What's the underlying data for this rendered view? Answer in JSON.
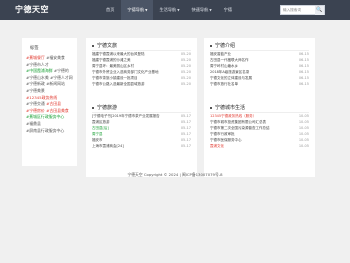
{
  "brand": {
    "logo": "宁德天空"
  },
  "nav": [
    {
      "label": "首页",
      "caret": ""
    },
    {
      "label": "宁德导航",
      "caret": "▼"
    },
    {
      "label": "生活导航",
      "caret": "▼"
    },
    {
      "label": "快速导航",
      "caret": "▼"
    },
    {
      "label": "宁德",
      "caret": ""
    }
  ],
  "search": {
    "placeholder": "输入搜索词",
    "button_icon": "🔍"
  },
  "sidebar": {
    "title": "标签",
    "tags": [
      {
        "text": "#蕉城餐厅",
        "color": "red"
      },
      {
        "text": "#福安美食",
        "color": "gray"
      },
      {
        "text": "#宁德市人才",
        "color": "gray"
      },
      {
        "text": "#中国霞浦海鲜",
        "color": "green"
      },
      {
        "text": "#宁德的",
        "color": "gray"
      },
      {
        "text": "#宁德山水美",
        "color": "gray"
      },
      {
        "text": "#宁德人才网",
        "color": "gray"
      },
      {
        "text": "#宁德新政",
        "color": "gray"
      },
      {
        "text": "#新闻网站",
        "color": "gray"
      },
      {
        "text": "#宁德美景",
        "color": "gray"
      },
      {
        "text": "#12345政务热线",
        "color": "red"
      },
      {
        "text": "#宁德交通",
        "color": "gray"
      },
      {
        "text": "#古田县",
        "color": "red"
      },
      {
        "text": "#宁德房价",
        "color": "red"
      },
      {
        "text": "#古田县美食",
        "color": "red"
      },
      {
        "text": "#蕉城区行政服务中心",
        "color": "green"
      },
      {
        "text": "#福鼎县",
        "color": "gray"
      },
      {
        "text": "#屏南县行政服务中心",
        "color": "gray"
      }
    ]
  },
  "panels": [
    {
      "title": "宁德文旅",
      "rows": [
        {
          "title": "福建宁德霞浦以来最大的台风登陆",
          "date": "05-20"
        },
        {
          "title": "福建宁德霞浦的沙滩之美",
          "date": "05-20"
        },
        {
          "title": "周宁县环：最美丽山区乡村",
          "date": "05-20"
        },
        {
          "title": "宁德市外贸企业入选商务部门文化产业基地",
          "date": "05-20"
        },
        {
          "title": "宁德市茶旅小镇建设一批项目",
          "date": "05-20"
        },
        {
          "title": "宁德市公路入选最新全国县域旅游",
          "date": "05-20"
        }
      ]
    },
    {
      "title": "宁德介绍",
      "rows": [
        {
          "title": "福安香菇产业",
          "date": "06-15"
        },
        {
          "title": "古田县一代楹联大师名作",
          "date": "06-15"
        },
        {
          "title": "周宁岭村山塘水乡",
          "date": "06-15"
        },
        {
          "title": "2018年A级旅游景区名录",
          "date": "06-15"
        },
        {
          "title": "宁德文化的立体建设与发展",
          "date": "06-15"
        },
        {
          "title": "宁德市旅行社名单",
          "date": "06-15"
        }
      ]
    },
    {
      "title": "宁德旅游",
      "rows": [
        {
          "title": "[宁德电子书]2019年宁德市茶产业发展报告",
          "date": "05-17",
          "color": "gray"
        },
        {
          "title": "霞浦区旅游",
          "date": "05-17",
          "color": "gray"
        },
        {
          "title": "古田县[后]",
          "date": "05-17",
          "color": "green"
        },
        {
          "title": "周宁县",
          "date": "05-17",
          "color": "green"
        },
        {
          "title": "福安市",
          "date": "05-17",
          "color": "gray"
        },
        {
          "title": "上海市霞浦商会[24]",
          "date": "05-17",
          "color": "gray"
        }
      ]
    },
    {
      "title": "宁德城市生活",
      "rows": [
        {
          "title": "12345宁德政务热线（服务）",
          "date": "10-05",
          "color": "red"
        },
        {
          "title": "宁德市城市投资集团有限公司汇总表",
          "date": "10-05",
          "color": "gray"
        },
        {
          "title": "宁德市第二次全国污染源普查工作总结",
          "date": "10-05",
          "color": "gray"
        },
        {
          "title": "宁德市行政审批",
          "date": "10-05",
          "color": "gray"
        },
        {
          "title": "宁德市医保服务中心",
          "date": "10-05",
          "color": "gray"
        },
        {
          "title": "霞浦文化",
          "date": "10-05",
          "color": "red"
        }
      ]
    }
  ],
  "footer": {
    "text": "宁德天空 Copyright © 2024 | 闽ICP备13007079号-8"
  }
}
